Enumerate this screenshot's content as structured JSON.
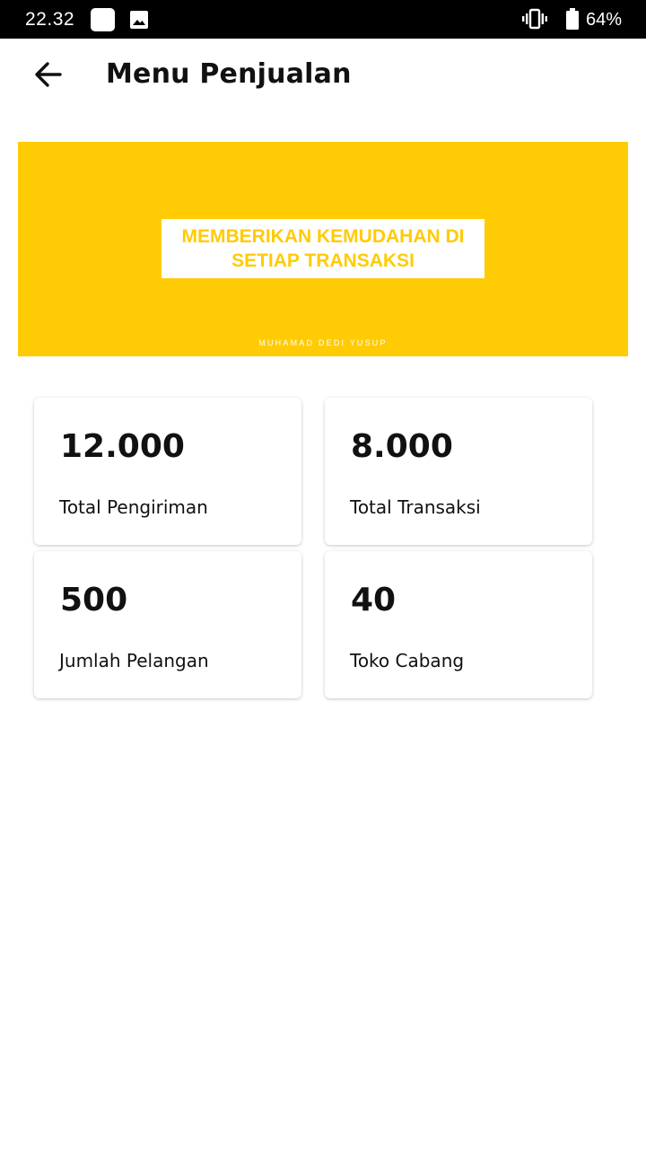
{
  "status_bar": {
    "time": "22.32",
    "battery": "64%",
    "icons": [
      "notification-square-icon",
      "image-icon",
      "vibrate-icon",
      "battery-icon"
    ]
  },
  "app_bar": {
    "title": "Menu Penjualan",
    "back_icon": "arrow-back-icon"
  },
  "banner": {
    "headline": "MEMBERIKAN KEMUDAHAN DI\nSETIAP TRANSAKSI",
    "credit": "MUHAMAD DEDI YUSUP",
    "background_color": "#ffcb05"
  },
  "stats": [
    {
      "value": "12.000",
      "label": "Total Pengiriman"
    },
    {
      "value": "8.000",
      "label": "Total Transaksi"
    },
    {
      "value": "500",
      "label": "Jumlah Pelangan"
    },
    {
      "value": "40",
      "label": "Toko Cabang"
    }
  ]
}
